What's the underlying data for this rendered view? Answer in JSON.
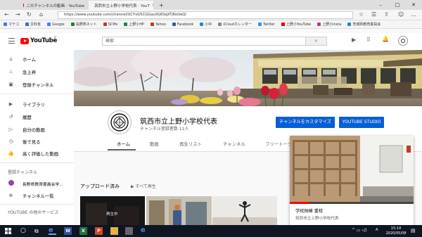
{
  "browser": {
    "tabs": [
      {
        "title": "このチャンネルの動画 - YouTube",
        "active": false
      },
      {
        "title": "筑西市立上野小学校代表 - YouT",
        "active": true
      }
    ],
    "new_tab": "+",
    "url": "https://www.youtube.com/channel/UCYvG5CGGau0G6SqXTjNoVaQ/"
  },
  "bookmarks": [
    {
      "label": "マテコ",
      "color": "#4a7dd8"
    },
    {
      "label": "文科省",
      "color": "#3c6fb8"
    },
    {
      "label": "Google",
      "color": "#4285f4"
    },
    {
      "label": "長野県ネット",
      "color": "#2b7a3a"
    },
    {
      "label": "SCMs",
      "color": "#c0392b"
    },
    {
      "label": "上野小HP",
      "color": "#1e8449"
    },
    {
      "label": "Yahoo",
      "color": "#c0392b"
    },
    {
      "label": "Facebook",
      "color": "#3b5998"
    },
    {
      "label": "小中",
      "color": "#2e86c1"
    },
    {
      "label": "iCloudカレンダー",
      "color": "#888888"
    },
    {
      "label": "Twitter",
      "color": "#1da1f2"
    },
    {
      "label": "上野小YouTube",
      "color": "#e00000"
    },
    {
      "label": "上野小insta",
      "color": "#c13584"
    },
    {
      "label": "茨城県教育委員会",
      "color": "#2e86c1"
    }
  ],
  "youtube": {
    "logo_text": "YouTube",
    "logo_region": "JP",
    "search_placeholder": "検索"
  },
  "sidebar": {
    "items": [
      {
        "label": "ホーム",
        "icon": "home-icon",
        "glyph": "⌂"
      },
      {
        "label": "急上昇",
        "icon": "trending-icon",
        "glyph": "♨"
      },
      {
        "label": "登録チャンネル",
        "icon": "subscriptions-icon",
        "glyph": "▣"
      },
      {
        "label": "ライブラリ",
        "icon": "library-icon",
        "glyph": "▶"
      },
      {
        "label": "履歴",
        "icon": "history-icon",
        "glyph": "↺"
      },
      {
        "label": "自分の動画",
        "icon": "your-videos-icon",
        "glyph": "▷"
      },
      {
        "label": "後で見る",
        "icon": "watch-later-icon",
        "glyph": "◷"
      },
      {
        "label": "高く評価した動画",
        "icon": "liked-videos-icon",
        "glyph": "👍"
      }
    ],
    "subscriptions_heading": "登録チャンネル",
    "subscriptions": [
      {
        "label": "長野県教育委員会学...",
        "icon": "channel-avatar-icon"
      },
      {
        "label": "チャンネル一覧",
        "icon": "browse-channels-icon"
      }
    ],
    "more_heading": "YOUTUBE の他のサービス"
  },
  "channel": {
    "name": "筑西市立上野小学校代表",
    "subscribers": "チャンネル登録者数 11人",
    "customize_button": "チャンネルをカスタマイズ",
    "studio_button": "YOUTUBE STUDIO",
    "tabs": [
      "ホーム",
      "動画",
      "再生リスト",
      "チャンネル",
      "フリートーク"
    ],
    "active_tab": 0
  },
  "uploads": {
    "title": "アップロード済み",
    "play_all": "すべて再生",
    "first_thumb_badge": "再生中"
  },
  "miniplayer": {
    "title": "学校探検 重校",
    "channel": "筑西市立上野小学校代表"
  },
  "taskbar": {
    "lang": "A",
    "time": "15:14",
    "date": "2020/05/08"
  }
}
